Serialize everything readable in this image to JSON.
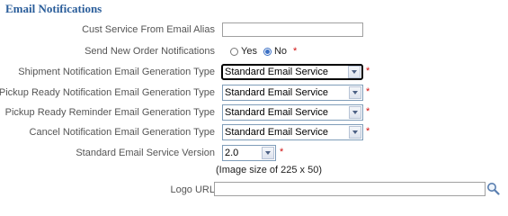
{
  "section": {
    "title": "Email Notifications"
  },
  "fields": {
    "cust_service_alias": {
      "label": "Cust Service From Email Alias",
      "value": ""
    },
    "send_new_order": {
      "label": "Send New Order Notifications",
      "options": [
        "Yes",
        "No"
      ],
      "selected": "No",
      "required_mark": "*"
    },
    "shipment_type": {
      "label": "Shipment Notification Email Generation Type",
      "value": "Standard Email Service",
      "required_mark": "*"
    },
    "pickup_ready_type": {
      "label": "Pickup Ready Notification Email Generation Type",
      "value": "Standard Email Service",
      "required_mark": "*"
    },
    "pickup_reminder_type": {
      "label": "Pickup Ready Reminder Email Generation Type",
      "value": "Standard Email Service",
      "required_mark": "*"
    },
    "cancel_type": {
      "label": "Cancel Notification Email Generation Type",
      "value": "Standard Email Service",
      "required_mark": "*"
    },
    "service_version": {
      "label": "Standard Email Service Version",
      "value": "2.0",
      "required_mark": "*"
    },
    "logo": {
      "hint": "(Image size of 225 x 50)",
      "label": "Logo URL",
      "value": ""
    }
  },
  "icons": {
    "logo_search": "search-icon"
  },
  "colors": {
    "title": "#2a5d9a",
    "required": "#d01010",
    "label": "#555555"
  }
}
